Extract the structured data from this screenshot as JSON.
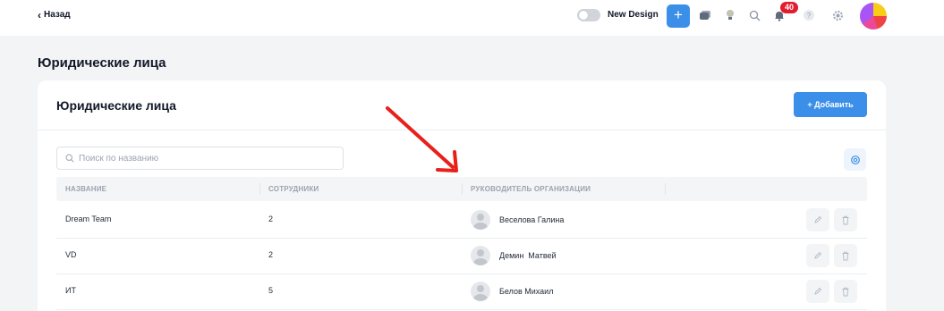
{
  "topbar": {
    "back_label": "Назад",
    "new_design_label": "New Design",
    "plus_label": "+",
    "notifications_count": "40",
    "help_label": "?",
    "accent": "#3b8fe8",
    "badge_color": "#e11d2e"
  },
  "page": {
    "title": "Юридические лица"
  },
  "card": {
    "title": "Юридические лица",
    "add_button": "+ Добавить",
    "search_placeholder": "Поиск по названию"
  },
  "table": {
    "columns": [
      "НАЗВАНИЕ",
      "СОТРУДНИКИ",
      "РУКОВОДИТЕЛЬ ОРГАНИЗАЦИИ"
    ],
    "rows": [
      {
        "name": "Dream Team",
        "employees": "2",
        "head": "Веселова Галина"
      },
      {
        "name": "VD",
        "employees": "2",
        "head": "Демин  Матвей"
      },
      {
        "name": "ИТ",
        "employees": "5",
        "head": "Белов Михаил"
      }
    ]
  },
  "annotation": {
    "arrow_color": "#e8201a"
  }
}
